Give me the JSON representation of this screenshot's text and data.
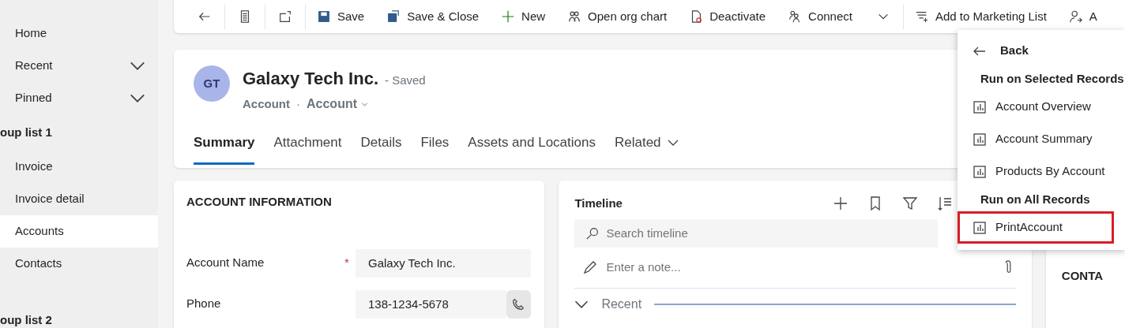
{
  "sidebar": {
    "items": [
      {
        "kind": "item",
        "label": "Home",
        "selected": false
      },
      {
        "kind": "item",
        "label": "Recent",
        "selected": false,
        "expanded": false
      },
      {
        "kind": "item",
        "label": "Pinned",
        "selected": false,
        "expanded": false
      },
      {
        "kind": "group",
        "label": "oup list 1"
      },
      {
        "kind": "item",
        "label": "Invoice",
        "selected": false
      },
      {
        "kind": "item",
        "label": "Invoice detail",
        "selected": false
      },
      {
        "kind": "item",
        "label": "Accounts",
        "selected": true
      },
      {
        "kind": "item",
        "label": "Contacts",
        "selected": false
      },
      {
        "kind": "group",
        "label": "oup list 2"
      }
    ]
  },
  "toolbar": {
    "buttons": [
      {
        "kind": "back"
      },
      {
        "kind": "form"
      },
      {
        "kind": "popout"
      },
      {
        "kind": "save",
        "label": "Save"
      },
      {
        "kind": "save_close",
        "label": "Save & Close"
      },
      {
        "kind": "new",
        "label": "New"
      },
      {
        "kind": "org",
        "label": "Open org chart"
      },
      {
        "kind": "deactivate",
        "label": "Deactivate"
      },
      {
        "kind": "connect",
        "label": "Connect"
      },
      {
        "kind": "more"
      },
      {
        "kind": "marketing",
        "label": "Add to Marketing List"
      },
      {
        "kind": "assign",
        "label": "A"
      }
    ]
  },
  "record": {
    "initials": "GT",
    "title": "Galaxy Tech Inc.",
    "status": "- Saved",
    "entity": "Account",
    "separator": "·",
    "form": "Account",
    "tabs": [
      {
        "label": "Summary",
        "selected": true
      },
      {
        "label": "Attachment",
        "selected": false
      },
      {
        "label": "Details",
        "selected": false
      },
      {
        "label": "Files",
        "selected": false
      },
      {
        "label": "Assets and Locations",
        "selected": false
      },
      {
        "label": "Related",
        "selected": false,
        "dropdown": true
      }
    ]
  },
  "account_information": {
    "title": "ACCOUNT INFORMATION",
    "fields": [
      {
        "kind": "text",
        "label": "Account Name",
        "required_mark": "*",
        "value": "Galaxy Tech Inc."
      },
      {
        "kind": "phone",
        "label": "Phone",
        "value": "138-1234-5678"
      }
    ]
  },
  "timeline": {
    "title": "Timeline",
    "search": {
      "placeholder": "Search timeline"
    },
    "note": {
      "placeholder": "Enter a note..."
    },
    "section": {
      "label": "Recent",
      "expanded": true
    }
  },
  "side_card": {
    "title": "CONTA"
  },
  "menu": {
    "items": [
      {
        "kind": "back",
        "label": "Back"
      },
      {
        "kind": "header",
        "label": "Run on Selected Records"
      },
      {
        "kind": "report",
        "label": "Account Overview",
        "highlighted": false
      },
      {
        "kind": "report",
        "label": "Account Summary",
        "highlighted": false
      },
      {
        "kind": "report",
        "label": "Products By Account",
        "highlighted": false
      },
      {
        "kind": "header",
        "label": "Run on All Records"
      },
      {
        "kind": "report",
        "label": "PrintAccount",
        "highlighted": true
      }
    ]
  }
}
